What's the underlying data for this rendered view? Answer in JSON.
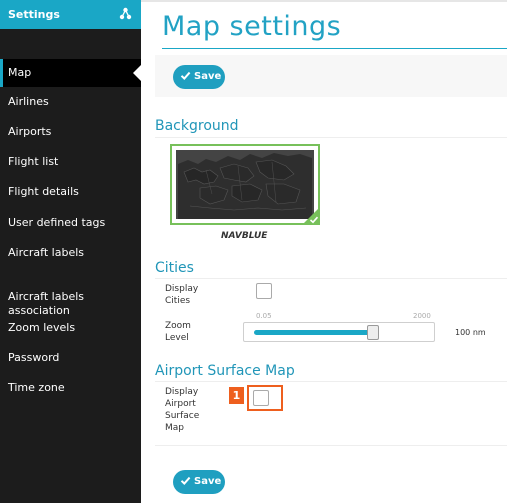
{
  "sidebar": {
    "title": "Settings",
    "header_icon": "tree-structure-icon",
    "items": [
      {
        "label": "Map",
        "active": true
      },
      {
        "label": "Airlines"
      },
      {
        "label": "Airports"
      },
      {
        "label": "Flight list"
      },
      {
        "label": "Flight details"
      },
      {
        "label": "User defined tags"
      },
      {
        "label": "Aircraft labels"
      },
      {
        "label": "Aircraft labels\nassociation"
      },
      {
        "label": "Zoom levels"
      },
      {
        "label": "Password"
      },
      {
        "label": "Time zone"
      }
    ]
  },
  "main": {
    "title": "Map settings",
    "save_label": "Save",
    "background": {
      "title": "Background",
      "selected_map": "NAVBLUE"
    },
    "cities": {
      "title": "Cities",
      "display_label": "Display\nCities",
      "display_checked": false,
      "zoom_label": "Zoom\nLevel",
      "zoom_min": "0.05",
      "zoom_max": "2000",
      "zoom_value": "100 nm",
      "zoom_fraction": 0.68
    },
    "airport_surface": {
      "title": "Airport Surface Map",
      "display_label": "Display\nAirport\nSurface\nMap",
      "display_checked": false,
      "step_marker": "1"
    }
  },
  "colors": {
    "accent": "#1aa7c6",
    "title_blue": "#22a2c4",
    "sidebar_bg": "#1c1c1c",
    "selected_border": "#77c05a",
    "step_marker": "#ee5f1e"
  }
}
